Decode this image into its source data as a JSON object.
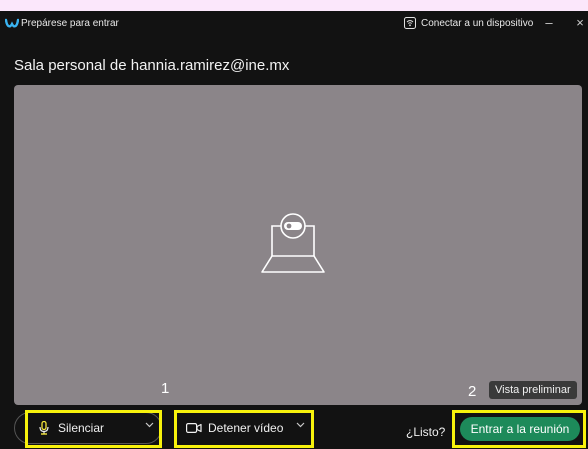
{
  "titlebar": {
    "title": "Prepárese para entrar",
    "connect_label": "Conectar a un dispositivo",
    "minimize": "–",
    "close": "×"
  },
  "room": {
    "title": "Sala personal de hannia.ramirez@ine.mx"
  },
  "preview": {
    "label": "Vista preliminar"
  },
  "annotations": {
    "one": "1",
    "two": "2"
  },
  "controls": {
    "mute_label": "Silenciar",
    "video_label": "Detener vídeo",
    "ready_label": "¿Listo?",
    "join_label": "Entrar a la reunión"
  },
  "icons": {
    "app": "webex-logo-icon",
    "connect": "wireless-device-icon",
    "camera": "camera-laptop-icon",
    "mic": "microphone-icon",
    "video": "video-camera-icon",
    "chevron": "chevron-down-icon"
  },
  "colors": {
    "background": "#fbe7fb",
    "window": "#121212",
    "preview": "#8b8589",
    "highlight": "#f7f20c",
    "join": "#1d8a5a"
  }
}
